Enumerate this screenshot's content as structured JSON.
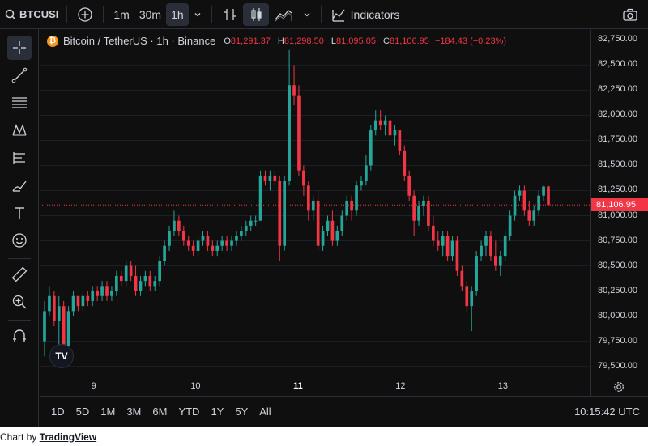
{
  "toolbar": {
    "symbol": "BTCUSI",
    "intervals": [
      "1m",
      "30m",
      "1h"
    ],
    "active_interval": "1h",
    "indicators_label": "Indicators"
  },
  "legend": {
    "title": "Bitcoin / TetherUS · 1h · Binance",
    "open_key": "O",
    "open": "81,291.37",
    "high_key": "H",
    "high": "81,298.50",
    "low_key": "L",
    "low": "81,095.05",
    "close_key": "C",
    "close": "81,106.95",
    "change": "−184.43 (−0.23%)"
  },
  "current_price_label": "81,106.95",
  "ranges": [
    "1D",
    "5D",
    "1M",
    "3M",
    "6M",
    "YTD",
    "1Y",
    "5Y",
    "All"
  ],
  "clock": "10:15:42 UTC",
  "attribution": {
    "prefix": "Chart by",
    "link": "TradingView"
  },
  "logo_text": "TV",
  "colors": {
    "up": "#26a69a",
    "down": "#f23645",
    "background": "#0f0f0f"
  },
  "icons": [
    "search-icon",
    "add-symbol-icon",
    "chevron-down-icon",
    "compare-icon",
    "candles-icon",
    "area-icon",
    "indicators-icon",
    "camera-icon",
    "crosshair-icon",
    "trendline-icon",
    "fib-icon",
    "pattern-icon",
    "forecast-icon",
    "brush-icon",
    "text-icon",
    "emoji-icon",
    "ruler-icon",
    "zoom-icon",
    "magnet-icon",
    "settings-gear-icon"
  ],
  "chart_data": {
    "type": "candlestick",
    "title": "Bitcoin / TetherUS · 1h · Binance",
    "y_ticks": [
      "82,750.00",
      "82,500.00",
      "82,250.00",
      "82,000.00",
      "81,750.00",
      "81,500.00",
      "81,250.00",
      "81,000.00",
      "80,750.00",
      "80,500.00",
      "80,250.00",
      "80,000.00",
      "79,750.00",
      "79,500.00"
    ],
    "ylim": [
      79400,
      82850
    ],
    "x_ticks": [
      {
        "label": "9",
        "bold": false
      },
      {
        "label": "10",
        "bold": false
      },
      {
        "label": "11",
        "bold": true
      },
      {
        "label": "12",
        "bold": false
      },
      {
        "label": "13",
        "bold": false
      }
    ],
    "last_price": 81106.95,
    "candles": [
      [
        79750,
        80150,
        79600,
        80050
      ],
      [
        80050,
        80300,
        80000,
        80200
      ],
      [
        80200,
        80250,
        79900,
        79950
      ],
      [
        79950,
        80200,
        79700,
        80100
      ],
      [
        80100,
        80150,
        79650,
        79700
      ],
      [
        79700,
        80100,
        79650,
        80050
      ],
      [
        80050,
        80250,
        80000,
        80200
      ],
      [
        80200,
        80150,
        80050,
        80100
      ],
      [
        80100,
        80250,
        80050,
        80200
      ],
      [
        80200,
        80250,
        80100,
        80150
      ],
      [
        80150,
        80300,
        80100,
        80250
      ],
      [
        80250,
        80300,
        80150,
        80200
      ],
      [
        80200,
        80350,
        80150,
        80300
      ],
      [
        80300,
        80350,
        80150,
        80200
      ],
      [
        80200,
        80300,
        80150,
        80250
      ],
      [
        80250,
        80450,
        80200,
        80400
      ],
      [
        80400,
        80450,
        80300,
        80350
      ],
      [
        80350,
        80550,
        80300,
        80500
      ],
      [
        80500,
        80550,
        80350,
        80400
      ],
      [
        80400,
        80500,
        80200,
        80250
      ],
      [
        80250,
        80400,
        80200,
        80350
      ],
      [
        80350,
        80450,
        80300,
        80400
      ],
      [
        80400,
        80450,
        80250,
        80300
      ],
      [
        80300,
        80400,
        80250,
        80350
      ],
      [
        80350,
        80600,
        80300,
        80550
      ],
      [
        80550,
        80750,
        80500,
        80700
      ],
      [
        80700,
        80900,
        80650,
        80850
      ],
      [
        80850,
        81050,
        80800,
        80950
      ],
      [
        80950,
        81000,
        80800,
        80850
      ],
      [
        80850,
        80900,
        80700,
        80750
      ],
      [
        80750,
        80800,
        80650,
        80700
      ],
      [
        80700,
        80750,
        80600,
        80650
      ],
      [
        80650,
        80800,
        80600,
        80750
      ],
      [
        80750,
        80850,
        80700,
        80800
      ],
      [
        80800,
        80850,
        80650,
        80700
      ],
      [
        80700,
        80750,
        80600,
        80650
      ],
      [
        80650,
        80750,
        80600,
        80700
      ],
      [
        80700,
        80800,
        80650,
        80750
      ],
      [
        80750,
        80800,
        80650,
        80700
      ],
      [
        80700,
        80800,
        80650,
        80750
      ],
      [
        80750,
        80850,
        80700,
        80800
      ],
      [
        80800,
        80900,
        80750,
        80850
      ],
      [
        80850,
        80950,
        80800,
        80900
      ],
      [
        80900,
        81000,
        80850,
        80950
      ],
      [
        80950,
        81000,
        80900,
        80950
      ],
      [
        80950,
        81450,
        80950,
        81400
      ],
      [
        81400,
        81450,
        81300,
        81350
      ],
      [
        81350,
        81450,
        81250,
        81400
      ],
      [
        81400,
        81450,
        81300,
        81350
      ],
      [
        81350,
        81400,
        80550,
        80700
      ],
      [
        80700,
        81400,
        80650,
        81350
      ],
      [
        81350,
        82650,
        81300,
        82300
      ],
      [
        82300,
        82500,
        82100,
        82200
      ],
      [
        82200,
        82300,
        81400,
        81450
      ],
      [
        81450,
        81500,
        81200,
        81300
      ],
      [
        81300,
        81350,
        80950,
        81050
      ],
      [
        81050,
        81200,
        80950,
        81150
      ],
      [
        81150,
        81250,
        80650,
        80700
      ],
      [
        80700,
        80900,
        80650,
        80850
      ],
      [
        80850,
        81000,
        80800,
        80950
      ],
      [
        80950,
        81050,
        80700,
        80750
      ],
      [
        80750,
        80900,
        80700,
        80850
      ],
      [
        80850,
        81050,
        80800,
        81000
      ],
      [
        81000,
        81200,
        80950,
        81150
      ],
      [
        81150,
        81200,
        80950,
        81050
      ],
      [
        81050,
        81350,
        81000,
        81300
      ],
      [
        81300,
        81400,
        81250,
        81350
      ],
      [
        81350,
        81600,
        81300,
        81500
      ],
      [
        81500,
        81900,
        81450,
        81850
      ],
      [
        81850,
        82050,
        81800,
        81950
      ],
      [
        81950,
        82050,
        81850,
        81900
      ],
      [
        81900,
        82000,
        81800,
        81950
      ],
      [
        81950,
        81950,
        81750,
        81800
      ],
      [
        81800,
        81900,
        81700,
        81850
      ],
      [
        81850,
        81850,
        81600,
        81650
      ],
      [
        81650,
        81700,
        81350,
        81400
      ],
      [
        81400,
        81450,
        81150,
        81200
      ],
      [
        81200,
        81250,
        80800,
        80950
      ],
      [
        80950,
        81150,
        80900,
        81100
      ],
      [
        81100,
        81200,
        81000,
        81150
      ],
      [
        81150,
        81200,
        80850,
        80900
      ],
      [
        80900,
        81000,
        80700,
        80750
      ],
      [
        80750,
        80850,
        80650,
        80700
      ],
      [
        80700,
        80850,
        80600,
        80800
      ],
      [
        80800,
        80850,
        80550,
        80600
      ],
      [
        80600,
        80800,
        80550,
        80750
      ],
      [
        80750,
        80800,
        80400,
        80450
      ],
      [
        80450,
        80500,
        80250,
        80300
      ],
      [
        80300,
        80350,
        80050,
        80100
      ],
      [
        80100,
        80300,
        79850,
        80250
      ],
      [
        80250,
        80650,
        80200,
        80600
      ],
      [
        80600,
        80750,
        80550,
        80700
      ],
      [
        80700,
        80850,
        80600,
        80800
      ],
      [
        80800,
        80850,
        80550,
        80600
      ],
      [
        80600,
        80750,
        80450,
        80500
      ],
      [
        80500,
        80650,
        80400,
        80600
      ],
      [
        80600,
        80850,
        80550,
        80800
      ],
      [
        80800,
        81050,
        80750,
        81000
      ],
      [
        81000,
        81250,
        80950,
        81200
      ],
      [
        81200,
        81300,
        81150,
        81250
      ],
      [
        81250,
        81300,
        81000,
        81050
      ],
      [
        81050,
        81150,
        80900,
        80950
      ],
      [
        80950,
        81100,
        80900,
        81050
      ],
      [
        81050,
        81250,
        81000,
        81200
      ],
      [
        81200,
        81300,
        81150,
        81290
      ],
      [
        81291.37,
        81298.5,
        81095.05,
        81106.95
      ]
    ]
  }
}
